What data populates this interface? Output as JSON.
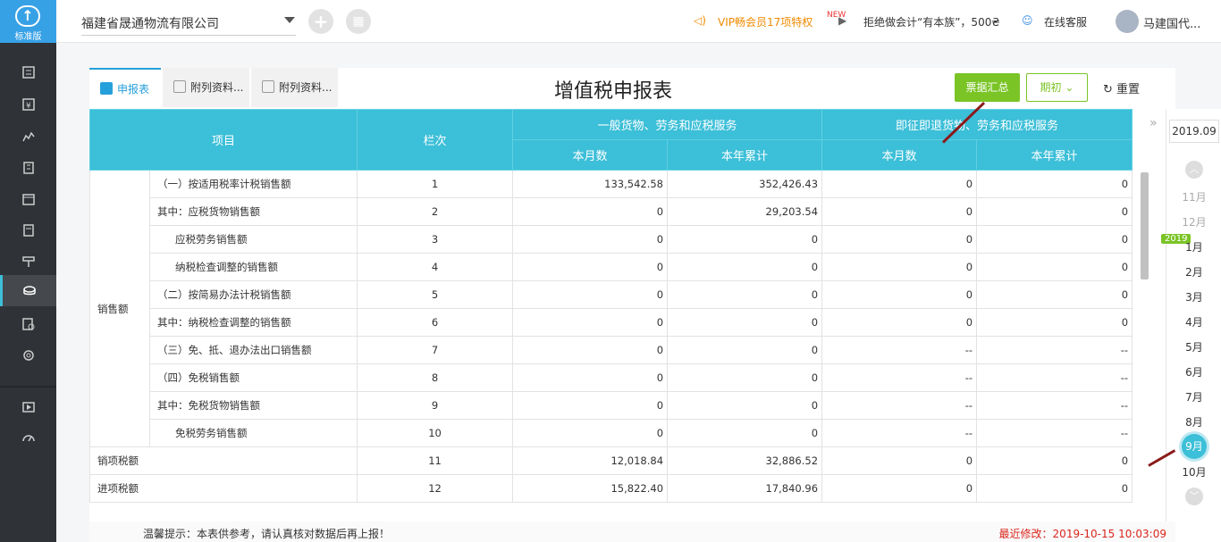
{
  "app": {
    "edition": "标准版"
  },
  "topbar": {
    "company": "福建省晟通物流有限公司",
    "vip": "VIP畅会员17项特权",
    "promo": "拒绝做会计“有本族”，500₴",
    "service": "在线客服",
    "user": "马建国代..."
  },
  "page": {
    "title": "增值税申报表",
    "tabs": [
      "申报表",
      "附列资料...",
      "附列资料..."
    ],
    "btn_summary": "票据汇总",
    "btn_period": "期初",
    "btn_reset": "重置",
    "tip": "温馨提示：本表供参考，请认真核对数据后再上报！",
    "modified": "最近修改：2019-10-15 10:03:09"
  },
  "table": {
    "h_item": "项目",
    "h_col": "栏次",
    "h_general": "一般货物、劳务和应税服务",
    "h_refund": "即征即退货物、劳务和应税服务",
    "h_month": "本月数",
    "h_year": "本年累计",
    "group": "销售额",
    "rows": [
      {
        "item": "（一）按适用税率计税销售额",
        "no": "1",
        "gm": "133,542.58",
        "gy": "352,426.43",
        "rm": "0",
        "ry": "0",
        "indent": false
      },
      {
        "item": "其中：应税货物销售额",
        "no": "2",
        "gm": "0",
        "gy": "29,203.54",
        "rm": "0",
        "ry": "0",
        "indent": false
      },
      {
        "item": "应税劳务销售额",
        "no": "3",
        "gm": "0",
        "gy": "0",
        "rm": "0",
        "ry": "0",
        "indent": true
      },
      {
        "item": "纳税检查调整的销售额",
        "no": "4",
        "gm": "0",
        "gy": "0",
        "rm": "0",
        "ry": "0",
        "indent": true
      },
      {
        "item": "（二）按简易办法计税销售额",
        "no": "5",
        "gm": "0",
        "gy": "0",
        "rm": "0",
        "ry": "0",
        "indent": false
      },
      {
        "item": "其中：纳税检查调整的销售额",
        "no": "6",
        "gm": "0",
        "gy": "0",
        "rm": "0",
        "ry": "0",
        "indent": false
      },
      {
        "item": "（三）免、抵、退办法出口销售额",
        "no": "7",
        "gm": "0",
        "gy": "0",
        "rm": "--",
        "ry": "--",
        "indent": false
      },
      {
        "item": "（四）免税销售额",
        "no": "8",
        "gm": "0",
        "gy": "0",
        "rm": "--",
        "ry": "--",
        "indent": false
      },
      {
        "item": "其中：免税货物销售额",
        "no": "9",
        "gm": "0",
        "gy": "0",
        "rm": "--",
        "ry": "--",
        "indent": false
      },
      {
        "item": "免税劳务销售额",
        "no": "10",
        "gm": "0",
        "gy": "0",
        "rm": "--",
        "ry": "--",
        "indent": true
      },
      {
        "item": "销项税额",
        "no": "11",
        "gm": "12,018.84",
        "gy": "32,886.52",
        "rm": "0",
        "ry": "0",
        "indent": false
      },
      {
        "item": "进项税额",
        "no": "12",
        "gm": "15,822.40",
        "gy": "17,840.96",
        "rm": "0",
        "ry": "0",
        "indent": false
      }
    ]
  },
  "period": {
    "current": "2019.09",
    "year_badge": "2019",
    "months": [
      "11月",
      "12月",
      "1月",
      "2月",
      "3月",
      "4月",
      "5月",
      "6月",
      "7月",
      "8月",
      "9月",
      "10月"
    ],
    "selected": "9月"
  }
}
